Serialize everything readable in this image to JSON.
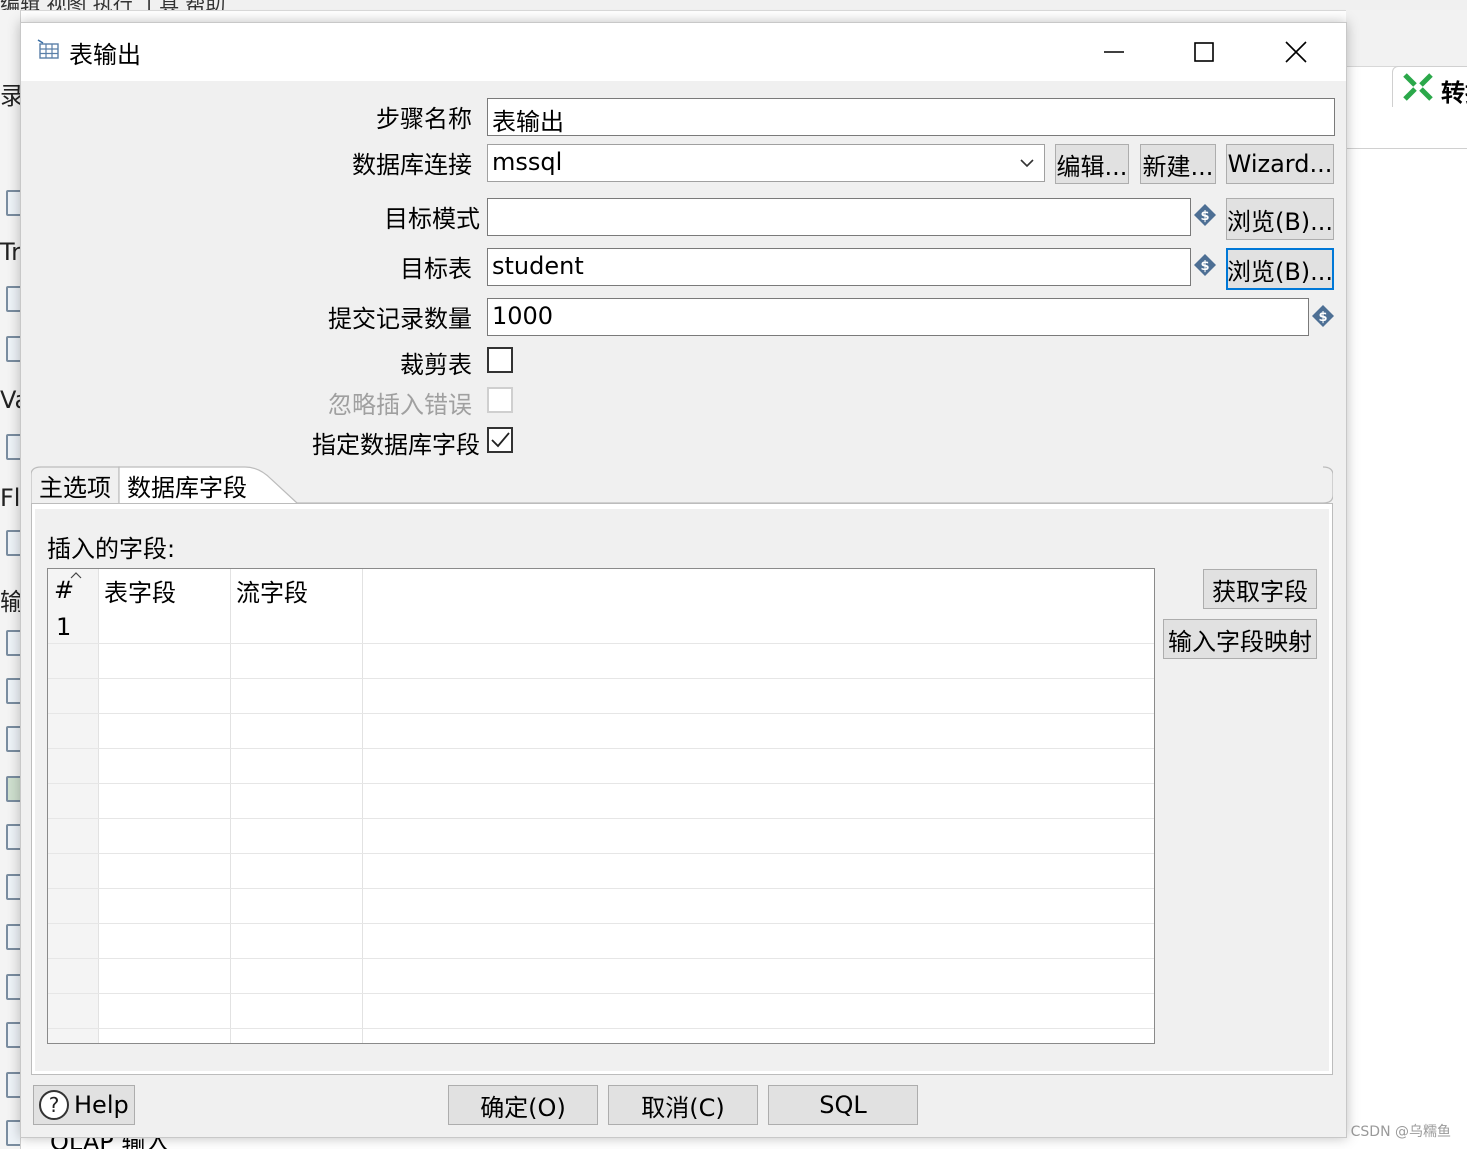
{
  "background": {
    "top_menu_text": "编辑  视图  执行  工具  帮助",
    "left_labels": [
      "录制",
      "Tr",
      "Va",
      "Fl",
      "输"
    ],
    "right_tab_label": "转换",
    "bottom_label": "OLAP 输入",
    "watermark": "CSDN @乌糯鱼"
  },
  "dialog": {
    "title": "表输出",
    "fields": {
      "step_name": {
        "label": "步骤名称",
        "value": "表输出"
      },
      "connection": {
        "label": "数据库连接",
        "value": "mssql",
        "edit_label": "编辑...",
        "new_label": "新建...",
        "wizard_label": "Wizard..."
      },
      "target_schema": {
        "label": "目标模式",
        "value": "",
        "browse_label": "浏览(B)..."
      },
      "target_table": {
        "label": "目标表",
        "value": "student",
        "browse_label": "浏览(B)..."
      },
      "commit_size": {
        "label": "提交记录数量",
        "value": "1000"
      },
      "truncate": {
        "label": "裁剪表",
        "checked": false
      },
      "ignore_errors": {
        "label": "忽略插入错误",
        "checked": false,
        "disabled": true
      },
      "specify_fields": {
        "label": "指定数据库字段",
        "checked": true
      }
    },
    "tabs": [
      {
        "label": "主选项",
        "active": false
      },
      {
        "label": "数据库字段",
        "active": true
      }
    ],
    "fields_tab": {
      "section_label": "插入的字段:",
      "columns": [
        "#",
        "表字段",
        "流字段"
      ],
      "rows": [
        {
          "num": "1",
          "table_field": "",
          "stream_field": ""
        }
      ],
      "get_fields_label": "获取字段",
      "mapping_label": "输入字段映射"
    },
    "buttons": {
      "help": "Help",
      "ok": "确定(O)",
      "cancel": "取消(C)",
      "sql": "SQL"
    },
    "colors": {
      "focus": "#0078d7",
      "button_bg": "#e1e1e1",
      "dialog_bg": "#f0f0f0"
    }
  }
}
